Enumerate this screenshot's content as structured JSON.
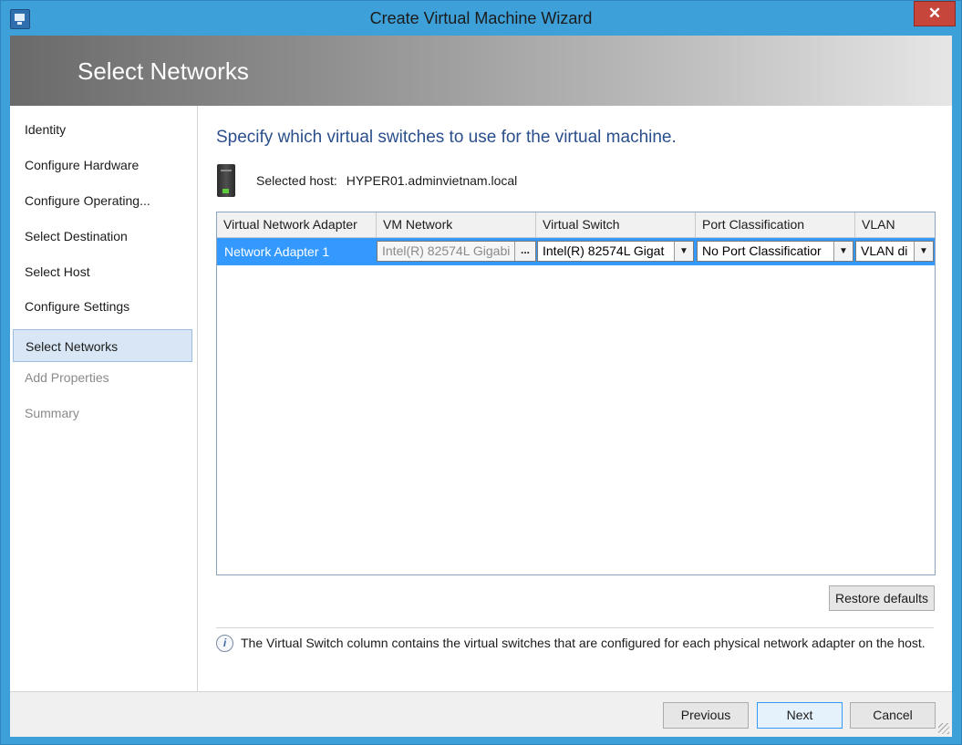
{
  "window": {
    "title": "Create Virtual Machine Wizard",
    "close_glyph": "✕"
  },
  "banner": {
    "title": "Select Networks"
  },
  "nav": {
    "items": [
      {
        "label": "Identity",
        "state": "done"
      },
      {
        "label": "Configure Hardware",
        "state": "done"
      },
      {
        "label": "Configure Operating...",
        "state": "done"
      },
      {
        "label": "Select Destination",
        "state": "done"
      },
      {
        "label": "Select Host",
        "state": "done"
      },
      {
        "label": "Configure Settings",
        "state": "done"
      },
      {
        "label": "Select Networks",
        "state": "active"
      },
      {
        "label": "Add Properties",
        "state": "disabled"
      },
      {
        "label": "Summary",
        "state": "disabled"
      }
    ]
  },
  "main": {
    "heading": "Specify which virtual switches to use for the virtual machine.",
    "host_label": "Selected host:",
    "host_value": "HYPER01.adminvietnam.local",
    "grid": {
      "columns": [
        "Virtual Network Adapter",
        "VM Network",
        "Virtual Switch",
        "Port Classification",
        "VLAN"
      ],
      "rows": [
        {
          "adapter": "Network Adapter 1",
          "vm_network": "Intel(R) 82574L Gigabi",
          "virtual_switch": "Intel(R) 82574L Gigat",
          "port_classification": "No Port Classificatior",
          "vlan": "VLAN di"
        }
      ],
      "browse_glyph": "...",
      "dropdown_glyph": "▼"
    },
    "restore_defaults": "Restore defaults",
    "info_glyph": "i",
    "info_text": "The Virtual Switch column contains the virtual switches that are configured for each physical network adapter on the host."
  },
  "footer": {
    "previous": "Previous",
    "next": "Next",
    "cancel": "Cancel"
  },
  "colors": {
    "accent": "#3399ff",
    "banner_gray": "#8b8b8b",
    "heading_blue": "#2b4f8c",
    "frame_blue": "#3ea0d8"
  }
}
